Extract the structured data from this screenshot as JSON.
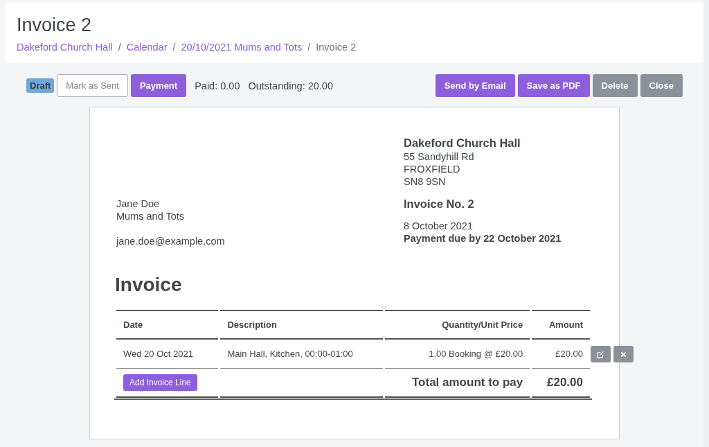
{
  "page": {
    "title": "Invoice 2"
  },
  "breadcrumb": [
    {
      "label": "Dakeford Church Hall",
      "kind": "link"
    },
    {
      "separator": "/",
      "label": "Calendar",
      "kind": "link"
    },
    {
      "separator": "/",
      "label": "20/10/2021 Mums and Tots",
      "kind": "link"
    },
    {
      "separator": "/",
      "label": "Invoice 2",
      "kind": "current"
    }
  ],
  "toolbar": {
    "status": "Draft",
    "buttons_left": [
      {
        "label": "Mark as Sent",
        "kind": "outline"
      },
      {
        "label": "Payment",
        "kind": "primary"
      }
    ],
    "paid": "Paid: 0.00",
    "outstanding": "Outstanding: 20.00",
    "buttons_right": [
      {
        "label": "Send by Email",
        "kind": "primary"
      },
      {
        "label": "Save as PDF",
        "kind": "primary"
      },
      {
        "label": "Delete",
        "kind": "secondary"
      },
      {
        "label": "Close",
        "kind": "secondary"
      }
    ]
  },
  "invoice": {
    "issuer": {
      "name": "Dakeford Church Hall",
      "address": [
        "55 Sandyhill Rd",
        "FROXFIELD",
        "SN8 9SN"
      ]
    },
    "recipient": [
      "Jane Doe",
      "Mums and Tots"
    ],
    "email": "jane.doe@example.com",
    "number": "Invoice No. 2",
    "date": "8 October 2021",
    "due": "Payment due by 22 October 2021",
    "heading": "Invoice",
    "columns": [
      "Date",
      "Description",
      "Quantity/Unit Price",
      "Amount"
    ],
    "rows": [
      {
        "date": "Wed 20 Oct 2021",
        "description": "Main Hall, Kitchen, 00:00-01:00",
        "quantity": "1.00 Booking @ £20.00",
        "amount": "£20.00"
      }
    ],
    "add_line": "Add Invoice Line",
    "total_label": "Total amount to pay",
    "total": "£20.00"
  }
}
